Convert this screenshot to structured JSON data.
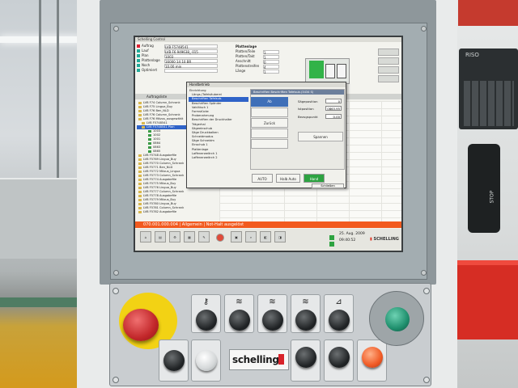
{
  "hmi": {
    "window_title": "Schelling Control",
    "info_rows": [
      {
        "label": "Auftrag",
        "value": "LVB F5748541"
      },
      {
        "label": "Lauf",
        "value": "LVB F6 949638_ 015"
      },
      {
        "label": "Plan",
        "value": "1003"
      },
      {
        "label": "Plattenlage",
        "value": "16000 14 10 BR"
      },
      {
        "label": "Noch",
        "value": "10.00 min"
      },
      {
        "label": "Optimiert",
        "value": ""
      }
    ],
    "params_title": "Plattenlage",
    "params": [
      {
        "label": "Platten/Teile",
        "value": "1"
      },
      {
        "label": "Platten/Takt",
        "value": "1"
      },
      {
        "label": "Anschnitt",
        "value": "0"
      },
      {
        "label": "Plattenstreifen",
        "value": "4"
      },
      {
        "label": "Länge",
        "value": "1"
      }
    ],
    "strip_label": "Auftragsliste",
    "tree_items": [
      {
        "label": "LVB F74 Column_Schrank",
        "sel": false,
        "leaf": false
      },
      {
        "label": "LVB F75 Lingua_Buy",
        "sel": false,
        "leaf": false
      },
      {
        "label": "LVB F76 Ben_NLD",
        "sel": false,
        "leaf": false
      },
      {
        "label": "LVB F76 Column_Schrank",
        "sel": false,
        "leaf": false
      },
      {
        "label": "LVB F76 Mitzus_ausgewählt",
        "sel": false,
        "leaf": false
      },
      {
        "label": "LVB F5748541",
        "sel": false,
        "leaf": false
      },
      {
        "label": "LVB F5748541 Plan",
        "sel": true,
        "leaf": false
      },
      {
        "label": "1003",
        "sel": false,
        "leaf": true
      },
      {
        "label": "1002",
        "sel": false,
        "leaf": true
      },
      {
        "label": "1001",
        "sel": false,
        "leaf": true
      },
      {
        "label": "0864",
        "sel": false,
        "leaf": true
      },
      {
        "label": "0863",
        "sel": false,
        "leaf": true
      },
      {
        "label": "0865",
        "sel": false,
        "leaf": true
      },
      {
        "label": "LVB F5748 Ausgabefile",
        "sel": false,
        "leaf": false
      },
      {
        "label": "LVB F5769 Lingua_Buy",
        "sel": false,
        "leaf": false
      },
      {
        "label": "LVB F5770 Column_Schrank",
        "sel": false,
        "leaf": false
      },
      {
        "label": "LVB F5771 Ben_NLD",
        "sel": false,
        "leaf": false
      },
      {
        "label": "LVB F5772 Mitzus_Lingua",
        "sel": false,
        "leaf": false
      },
      {
        "label": "LVB F5773 Column_Schrank",
        "sel": false,
        "leaf": false
      },
      {
        "label": "LVB F5774 Ausgabefile",
        "sel": false,
        "leaf": false
      },
      {
        "label": "LVB F5775 Mitzus_Buy",
        "sel": false,
        "leaf": false
      },
      {
        "label": "LVB F5776 Lingua_Buy",
        "sel": false,
        "leaf": false
      },
      {
        "label": "LVB F5777 Column_Schrank",
        "sel": false,
        "leaf": false
      },
      {
        "label": "LVB F5778 Ausgabefile",
        "sel": false,
        "leaf": false
      },
      {
        "label": "LVB F5779 Mitzus_Buy",
        "sel": false,
        "leaf": false
      },
      {
        "label": "LVB F5780 Lingua_Buy",
        "sel": false,
        "leaf": false
      },
      {
        "label": "LVB F5781 Column_Schrank",
        "sel": false,
        "leaf": false
      },
      {
        "label": "LVB F5782 Ausgabefile",
        "sel": false,
        "leaf": false
      }
    ],
    "dialog": {
      "title": "Handbetrieb",
      "tree": [
        {
          "label": "Einrichtung",
          "sel": false
        },
        {
          "label": "Längs-/Tafelsäuberei",
          "sel": false
        },
        {
          "label": "Beschriften Tafelsub.",
          "sel": true
        },
        {
          "label": "Beschriften Spänder",
          "sel": false
        },
        {
          "label": "Vakiltisch 1",
          "sel": false
        },
        {
          "label": "Formstücke",
          "sel": false
        },
        {
          "label": "Probenahmung",
          "sel": false
        },
        {
          "label": "Beschriften der Druckhalter",
          "sel": false
        },
        {
          "label": "Trägerhal",
          "sel": false
        },
        {
          "label": "Sägeeinschub",
          "sel": false
        },
        {
          "label": "Säge Druckbalken",
          "sel": false
        },
        {
          "label": "Schneidmodus",
          "sel": false
        },
        {
          "label": "Säge Schneidm",
          "sel": false
        },
        {
          "label": "Einschub 1",
          "sel": false
        },
        {
          "label": "Plattenlage",
          "sel": false
        },
        {
          "label": "Laffenerweitrch 1",
          "sel": false
        },
        {
          "label": "Laffenerweitrch 2",
          "sel": false
        }
      ],
      "panel_header": "Beschriften Beschriften Tafelsub.(3434 S)",
      "blue_btn": "Ab",
      "btn_zurueck": "Zurück",
      "label_1": "Sägeposition",
      "label_2": "Istposition",
      "label_3": "Bezugspunkt",
      "val_1": "0",
      "val_2": "0863.95",
      "val_3": "0.00",
      "btn_spannen": "Spannen",
      "btn_auto": "AUTO",
      "btn_halb": "Halb Auto",
      "btn_hand": "Hand",
      "close": "Schließen"
    },
    "alarm_text": "070.001.000.004 | Allgemein | Not-Halt ausgelöst",
    "date": "25. Aug. 2009",
    "time": "09:40:52",
    "logo": "SCHELLING"
  },
  "panel": {
    "brand": "schelling"
  },
  "background": {
    "keypad_label": "RISO",
    "handheld_label": "STOP"
  }
}
